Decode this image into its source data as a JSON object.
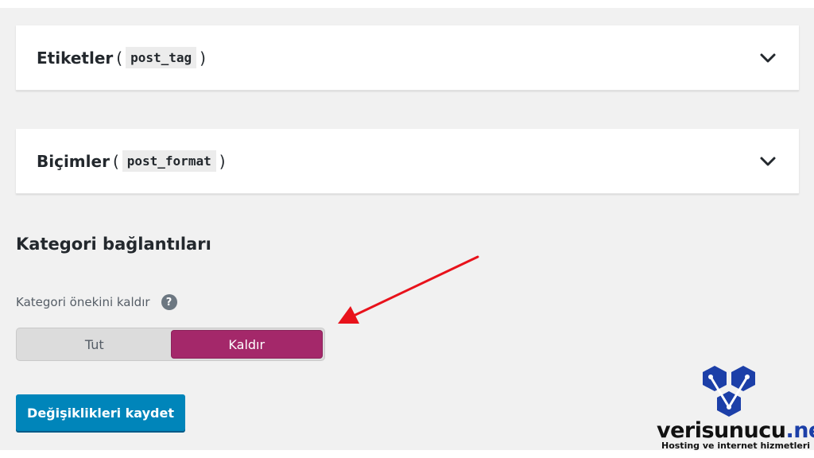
{
  "accordions": [
    {
      "title": "Etiketler",
      "code": "post_tag",
      "open_paren": "(",
      "close_paren": ")",
      "icon": "chevron-down-icon"
    },
    {
      "title": "Biçimler",
      "code": "post_format",
      "open_paren": "(",
      "close_paren": ")",
      "icon": "chevron-down-icon"
    }
  ],
  "category_links": {
    "title": "Kategori bağlantıları",
    "field_label": "Kategori önekini kaldır",
    "help_icon_glyph": "?",
    "toggle": {
      "options": [
        "Tut",
        "Kaldır"
      ],
      "selected": "Kaldır"
    }
  },
  "save_button": {
    "label": "Değişiklikleri kaydet"
  },
  "brand": {
    "name_prefix": "verisunucu",
    "name_suffix": ".net",
    "tagline": "Hosting ve internet hizmetleri"
  },
  "colors": {
    "accent_toggle": "#a4286a",
    "primary_button": "#0085ba",
    "annotation_arrow": "#e8121b",
    "brand_blue": "#1c3fa8"
  }
}
